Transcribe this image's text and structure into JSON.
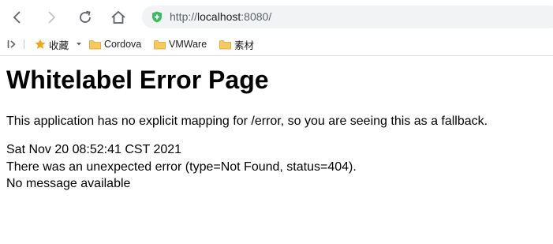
{
  "browser": {
    "url_scheme": "http://",
    "url_host": "localhost",
    "url_rest": ":8080/",
    "icons": {
      "back": "back-arrow-icon",
      "forward": "forward-arrow-icon",
      "reload": "reload-icon",
      "home": "home-icon",
      "security": "shield-icon"
    }
  },
  "bookmarks": {
    "items": [
      {
        "label": "收藏",
        "icon": "star-icon"
      },
      {
        "label": "Cordova",
        "icon": "folder-icon"
      },
      {
        "label": "VMWare",
        "icon": "folder-icon"
      },
      {
        "label": "素材",
        "icon": "folder-icon"
      }
    ]
  },
  "page": {
    "title": "Whitelabel Error Page",
    "description": "This application has no explicit mapping for /error, so you are seeing this as a fallback.",
    "timestamp": "Sat Nov 20 08:52:41 CST 2021",
    "error_line": "There was an unexpected error (type=Not Found, status=404).",
    "message": "No message available"
  },
  "colors": {
    "shield": "#3dbb61",
    "star": "#f4a419",
    "folder": "#f7c95c"
  }
}
